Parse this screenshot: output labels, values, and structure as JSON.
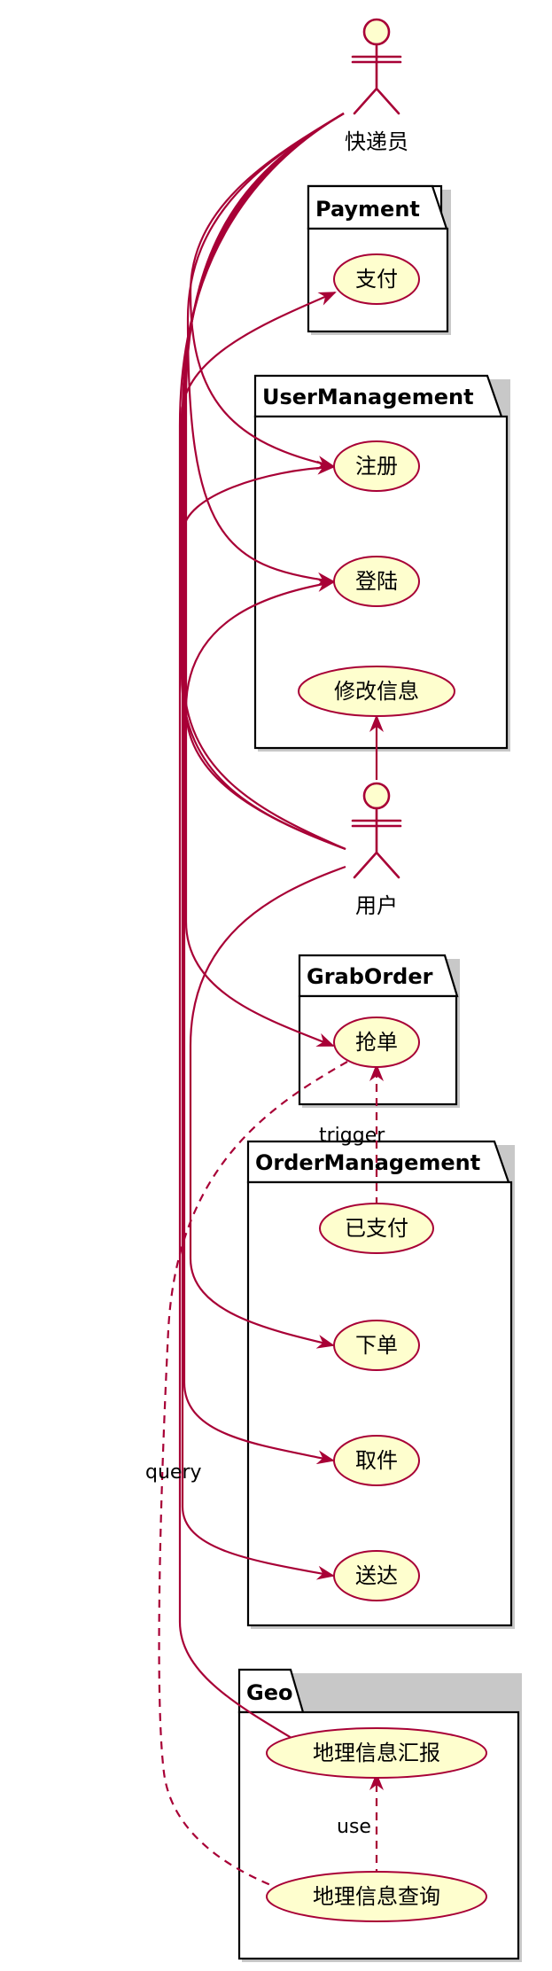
{
  "diagram": {
    "colors": {
      "accent": "#a80036",
      "usecase_fill": "#fefece",
      "package_border": "#000000",
      "shadow": "#c8c8c8"
    },
    "actors": {
      "courier": {
        "label": "快递员"
      },
      "user": {
        "label": "用户"
      }
    },
    "packages": {
      "payment": {
        "title": "Payment"
      },
      "user_management": {
        "title": "UserManagement"
      },
      "grab_order": {
        "title": "GrabOrder"
      },
      "order_management": {
        "title": "OrderManagement"
      },
      "geo": {
        "title": "Geo"
      }
    },
    "usecases": {
      "pay": {
        "label": "支付"
      },
      "register": {
        "label": "注册"
      },
      "login": {
        "label": "登陆"
      },
      "edit_info": {
        "label": "修改信息"
      },
      "grab": {
        "label": "抢单"
      },
      "paid": {
        "label": "已支付"
      },
      "place_order": {
        "label": "下单"
      },
      "pickup": {
        "label": "取件"
      },
      "deliver": {
        "label": "送达"
      },
      "geo_report": {
        "label": "地理信息汇报"
      },
      "geo_query": {
        "label": "地理信息查询"
      }
    },
    "edge_labels": {
      "trigger": "trigger",
      "query": "query",
      "use": "use"
    }
  }
}
